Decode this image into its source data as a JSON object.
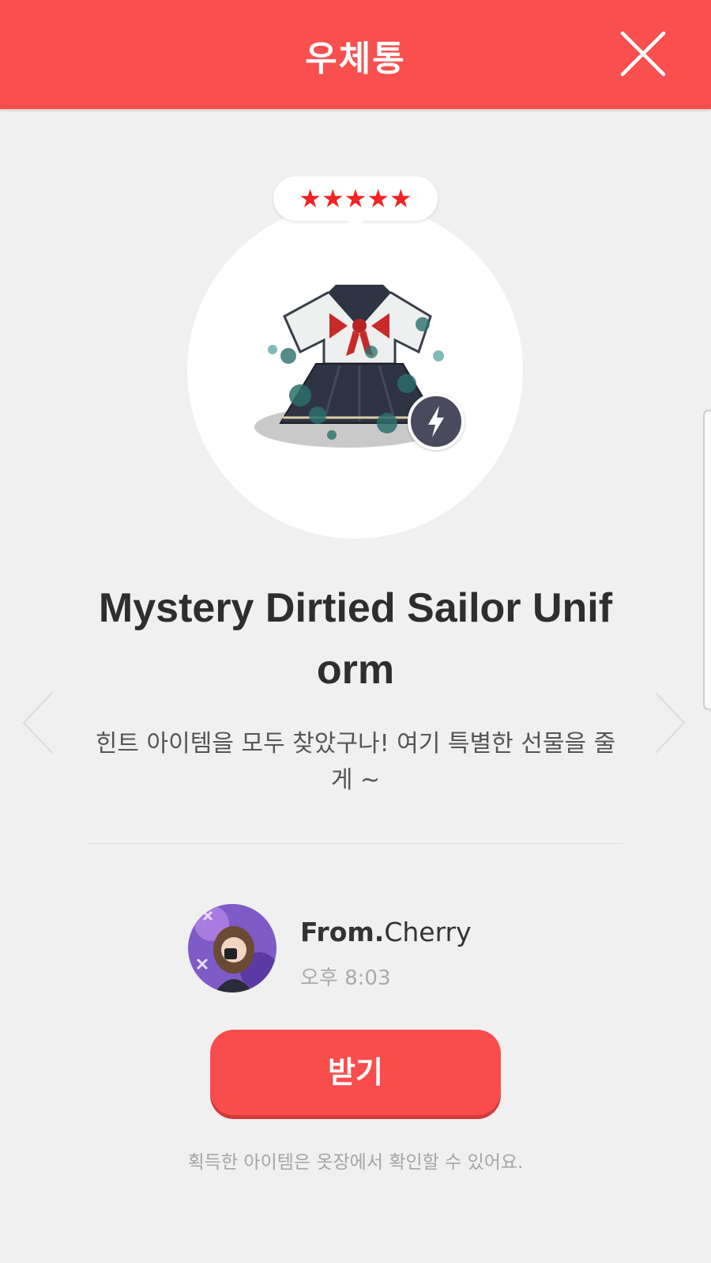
{
  "header": {
    "title": "우체통",
    "close_icon": "close-icon"
  },
  "item": {
    "rating_stars": 5,
    "stars_text": "★★★★★",
    "name": "Mystery Dirtied Sailor Uniform",
    "badge_icon": "lightning-icon",
    "message": "힌트 아이템을 모두 찾았구나! 여기 특별한 선물을 줄게 ~"
  },
  "navigation": {
    "prev_icon": "chevron-left-icon",
    "next_icon": "chevron-right-icon"
  },
  "sender": {
    "prefix": "From.",
    "name": "Cherry",
    "time": "오후 8:03"
  },
  "actions": {
    "receive_label": "받기"
  },
  "footer_note": "획득한 아이템은 옷장에서 확인할 수 있어요.",
  "colors": {
    "header": "#f94f4f",
    "button": "#f94d4d",
    "star": "#f22323",
    "background": "#f0f0f0"
  }
}
